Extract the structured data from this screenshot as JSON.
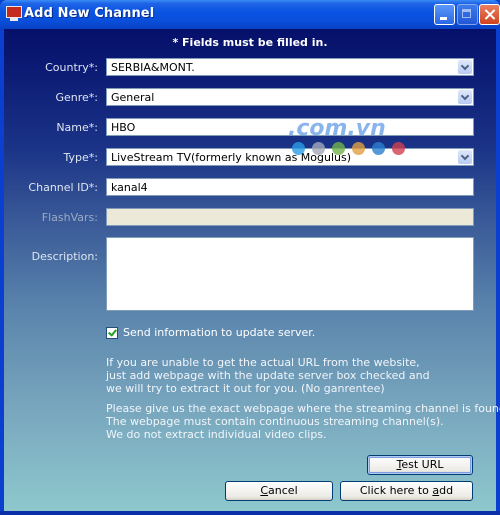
{
  "window": {
    "title": "Add New Channel",
    "minimize_label": "Minimize",
    "maximize_label": "Maximize",
    "close_label": "Close"
  },
  "form": {
    "notice": "* Fields must be filled in.",
    "country": {
      "label": "Country*:",
      "value": "SERBIA&MONT."
    },
    "genre": {
      "label": "Genre*:",
      "value": "General"
    },
    "name": {
      "label": "Name*:",
      "value": "HBO"
    },
    "type": {
      "label": "Type*:",
      "value": "LiveStream TV(formerly known as Mogulus)"
    },
    "channel_id": {
      "label": "Channel ID*:",
      "value": "kanal4"
    },
    "flashvars": {
      "label": "FlashVars:",
      "value": ""
    },
    "description": {
      "label": "Description:",
      "value": ""
    },
    "send_update": {
      "label": "Send information to update server.",
      "checked": true
    }
  },
  "info": {
    "paragraph1": "If you are unable to get the actual URL from the website,\njust add webpage with the update server box checked and\nwe will try to extract it out for you. (No ganrentee)",
    "paragraph2": "Please give us the exact webpage where the streaming channel is found.\nThe webpage must contain continuous streaming channel(s).\nWe do not extract individual video clips."
  },
  "buttons": {
    "test_url": {
      "mnemonic": "T",
      "rest": "est URL"
    },
    "cancel": {
      "mnemonic": "C",
      "rest": "ancel"
    },
    "add": {
      "prefix": "Click here to ",
      "mnemonic": "a",
      "rest": "dd"
    }
  },
  "watermark": {
    "text": ".com.vn",
    "dot_colors": [
      "#2a9be6",
      "#a3a8b8",
      "#6fb04a",
      "#e0a040",
      "#2a7fd0",
      "#d04050"
    ]
  }
}
